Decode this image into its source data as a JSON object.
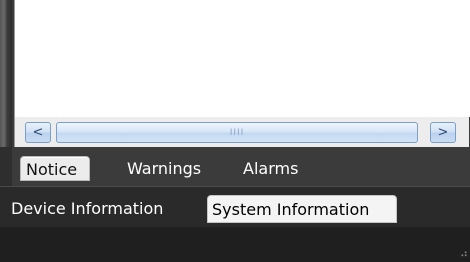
{
  "scrollbar": {
    "left_arrow": "<",
    "right_arrow": ">",
    "thumb_grip": "IIII"
  },
  "message_tabs": [
    {
      "label": "Notice",
      "active": true
    },
    {
      "label": "Warnings",
      "active": false
    },
    {
      "label": "Alarms",
      "active": false
    }
  ],
  "info_tabs": [
    {
      "label": "Device Information",
      "active": false
    },
    {
      "label": "System Information",
      "active": true
    }
  ],
  "status_bar": {
    "resize_grip": "⠴"
  }
}
